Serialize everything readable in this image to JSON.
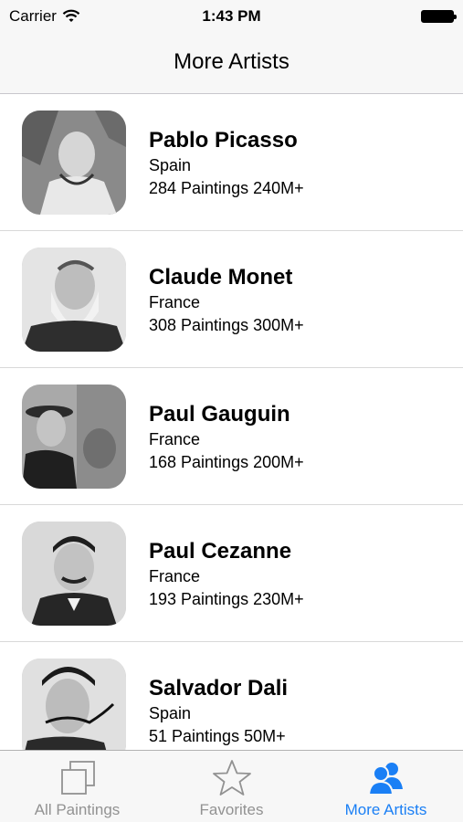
{
  "status_bar": {
    "carrier": "Carrier",
    "time": "1:43 PM"
  },
  "nav": {
    "title": "More Artists"
  },
  "artists": [
    {
      "name": "Pablo Picasso",
      "country": "Spain",
      "stats": "284 Paintings 240M+"
    },
    {
      "name": "Claude Monet",
      "country": "France",
      "stats": "308 Paintings 300M+"
    },
    {
      "name": "Paul Gauguin",
      "country": "France",
      "stats": "168 Paintings 200M+"
    },
    {
      "name": "Paul Cezanne",
      "country": "France",
      "stats": "193 Paintings 230M+"
    },
    {
      "name": "Salvador Dali",
      "country": "Spain",
      "stats": "51 Paintings 50M+"
    }
  ],
  "tab_bar": {
    "tabs": [
      {
        "label": "All Paintings",
        "icon": "stacked-squares-icon",
        "active": false
      },
      {
        "label": "Favorites",
        "icon": "star-icon",
        "active": false
      },
      {
        "label": "More Artists",
        "icon": "people-icon",
        "active": true
      }
    ]
  },
  "colors": {
    "accent": "#1a7ff5",
    "inactive": "#929292",
    "bar_background": "#f7f7f7"
  }
}
